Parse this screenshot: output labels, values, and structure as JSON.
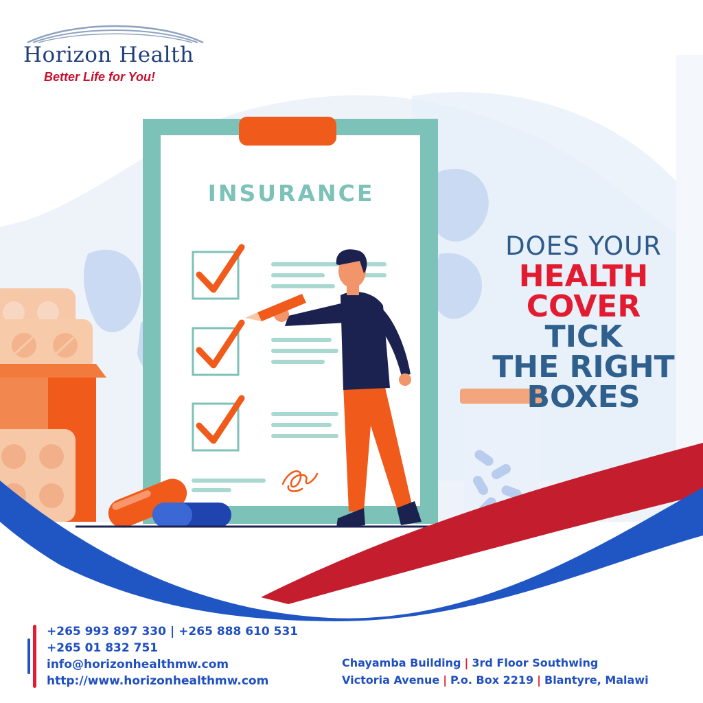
{
  "brand": {
    "name": "Horizon Health",
    "tagline": "Better Life for You!"
  },
  "clipboard": {
    "title": "INSURANCE",
    "checkboxes": [
      "checked",
      "checked",
      "checked"
    ]
  },
  "headline": {
    "line1": "DOES YOUR",
    "line2": "HEALTH",
    "line3": "COVER",
    "line4": "TICK",
    "line5": "THE RIGHT",
    "line6": "BOXES"
  },
  "contact": {
    "phone1": "+265 993 897 330",
    "phone2": "+265 888 610 531",
    "phone3": "+265 01 832 751",
    "email": "info@horizonhealthmw.com",
    "website": "http://www.horizonhealthmw.com",
    "separator": "|"
  },
  "address": {
    "building": "Chayamba Building",
    "floor": "3rd Floor Southwing",
    "street": "Victoria Avenue",
    "box": "P.o. Box 2219",
    "city": "Blantyre, Malawi",
    "separator": "|"
  },
  "colors": {
    "accent_red": "#e21b30",
    "accent_blue": "#1f56c4",
    "brand_navy": "#1f3f7a",
    "teal": "#7cc2b8",
    "orange": "#f05a1a"
  }
}
